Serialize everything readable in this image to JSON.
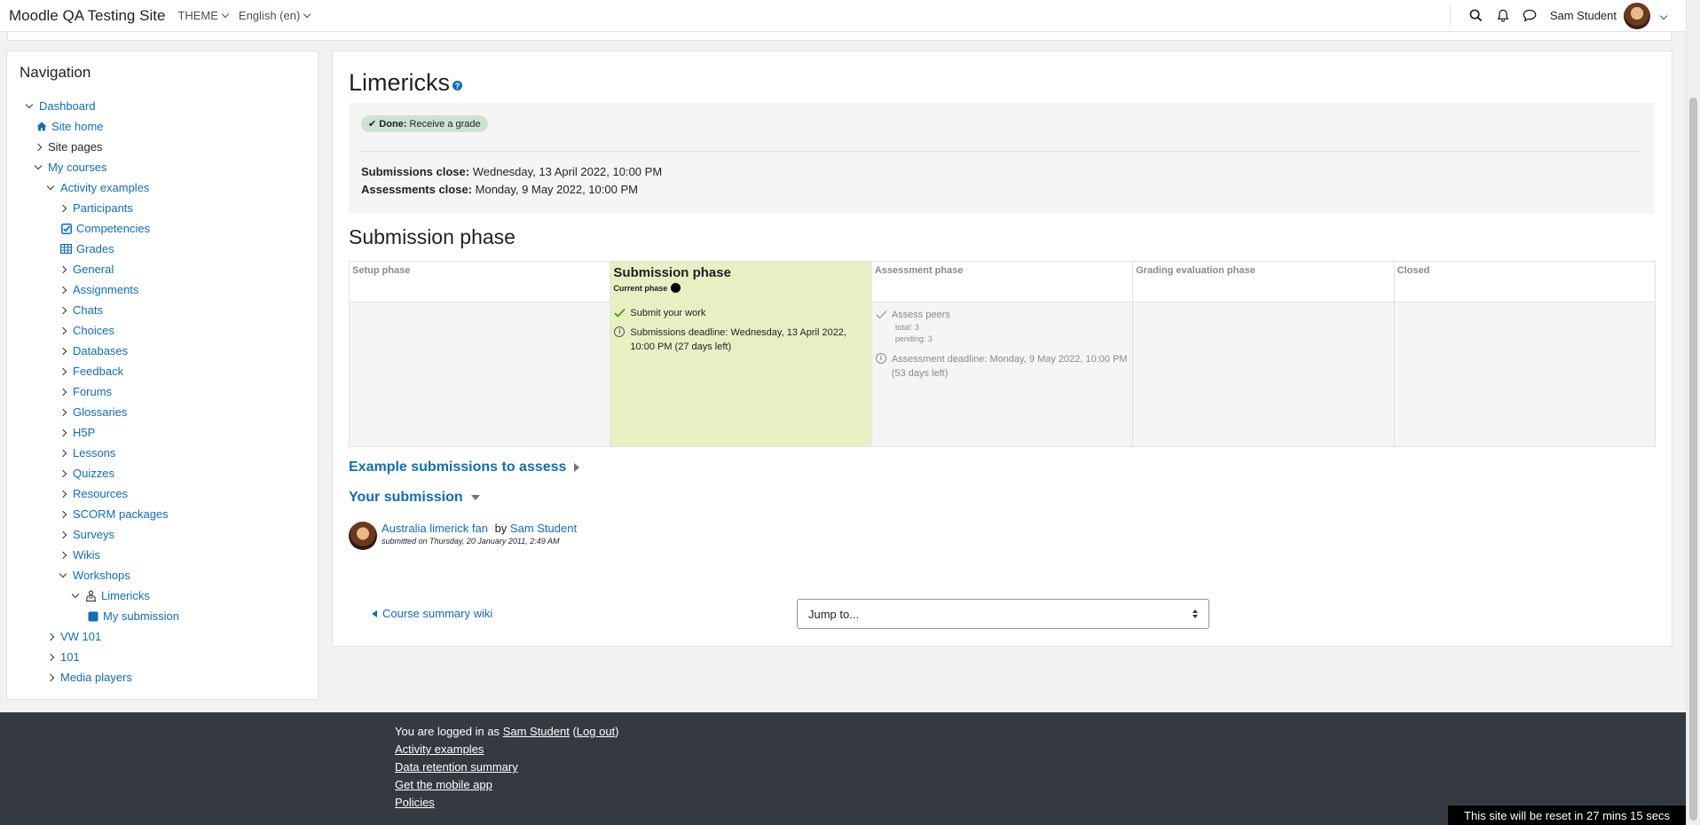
{
  "navbar": {
    "brand": "Moodle QA Testing Site",
    "theme_label": "THEME",
    "language_label": "English (en)",
    "user_name": "Sam Student"
  },
  "navigation": {
    "title": "Navigation",
    "items": [
      {
        "label": "Dashboard",
        "level": 0,
        "toggle": "open",
        "link": true
      },
      {
        "label": "Site home",
        "level": 1,
        "toggle": "none",
        "icon": "home-icon",
        "link": true
      },
      {
        "label": "Site pages",
        "level": 1,
        "toggle": "closed",
        "link": false
      },
      {
        "label": "My courses",
        "level": 1,
        "toggle": "open",
        "link": true
      },
      {
        "label": "Activity examples",
        "level": 2,
        "toggle": "open",
        "link": true
      },
      {
        "label": "Participants",
        "level": 3,
        "toggle": "closed",
        "link": true
      },
      {
        "label": "Competencies",
        "level": 3,
        "toggle": "none",
        "icon": "checkbox-icon",
        "link": true
      },
      {
        "label": "Grades",
        "level": 3,
        "toggle": "none",
        "icon": "table-icon",
        "link": true
      },
      {
        "label": "General",
        "level": 3,
        "toggle": "closed",
        "link": true
      },
      {
        "label": "Assignments",
        "level": 3,
        "toggle": "closed",
        "link": true
      },
      {
        "label": "Chats",
        "level": 3,
        "toggle": "closed",
        "link": true
      },
      {
        "label": "Choices",
        "level": 3,
        "toggle": "closed",
        "link": true
      },
      {
        "label": "Databases",
        "level": 3,
        "toggle": "closed",
        "link": true
      },
      {
        "label": "Feedback",
        "level": 3,
        "toggle": "closed",
        "link": true
      },
      {
        "label": "Forums",
        "level": 3,
        "toggle": "closed",
        "link": true
      },
      {
        "label": "Glossaries",
        "level": 3,
        "toggle": "closed",
        "link": true
      },
      {
        "label": "H5P",
        "level": 3,
        "toggle": "closed",
        "link": true
      },
      {
        "label": "Lessons",
        "level": 3,
        "toggle": "closed",
        "link": true
      },
      {
        "label": "Quizzes",
        "level": 3,
        "toggle": "closed",
        "link": true
      },
      {
        "label": "Resources",
        "level": 3,
        "toggle": "closed",
        "link": true
      },
      {
        "label": "SCORM packages",
        "level": 3,
        "toggle": "closed",
        "link": true
      },
      {
        "label": "Surveys",
        "level": 3,
        "toggle": "closed",
        "link": true
      },
      {
        "label": "Wikis",
        "level": 3,
        "toggle": "closed",
        "link": true
      },
      {
        "label": "Workshops",
        "level": 3,
        "toggle": "open",
        "link": true
      },
      {
        "label": "Limericks",
        "level": 4,
        "toggle": "open",
        "icon": "workshop-icon",
        "link": true,
        "bold": true
      },
      {
        "label": "My submission",
        "level": 5,
        "toggle": "none",
        "icon": "square-icon",
        "link": true
      },
      {
        "label": "VW 101",
        "level": 2,
        "toggle": "closed",
        "link": true
      },
      {
        "label": "101",
        "level": 2,
        "toggle": "closed",
        "link": true
      },
      {
        "label": "Media players",
        "level": 2,
        "toggle": "closed",
        "link": true
      }
    ]
  },
  "main": {
    "title": "Limericks",
    "completion_badge": {
      "strong": "Done:",
      "text": "Receive a grade"
    },
    "submissions_close": {
      "label": "Submissions close:",
      "value": "Wednesday, 13 April 2022, 10:00 PM"
    },
    "assessments_close": {
      "label": "Assessments close:",
      "value": "Monday, 9 May 2022, 10:00 PM"
    },
    "phase_heading": "Submission phase",
    "phases": {
      "setup": "Setup phase",
      "submission": "Submission phase",
      "current_label": "Current phase",
      "assessment": "Assessment phase",
      "grading": "Grading evaluation phase",
      "closed": "Closed"
    },
    "submission_tasks": {
      "submit": "Submit your work",
      "deadline": "Submissions deadline: Wednesday, 13 April 2022, 10:00 PM (27 days left)"
    },
    "assessment_tasks": {
      "assess": "Assess peers",
      "total": "total: 3",
      "pending": "pending: 3",
      "deadline": "Assessment deadline: Monday, 9 May 2022, 10:00 PM (53 days left)"
    },
    "example_submissions": "Example submissions to assess",
    "your_submission": "Your submission",
    "submission": {
      "title": "Australia limerick fan",
      "by": "by",
      "author": "Sam Student",
      "meta": "submitted on Thursday, 20 January 2011, 2:49 AM"
    },
    "prev_link": "Course summary wiki",
    "jump_placeholder": "Jump to..."
  },
  "footer": {
    "logged_in_prefix": "You are logged in as",
    "user": "Sam Student",
    "logout": "Log out",
    "links": [
      "Activity examples",
      "Data retention summary",
      "Get the mobile app",
      "Policies"
    ],
    "reset_notice": "This site will be reset in 27 mins 15 secs"
  },
  "colors": {
    "link": "#0f6cbf",
    "active_phase": "#e7f0c3",
    "footer_bg": "#343a40"
  }
}
